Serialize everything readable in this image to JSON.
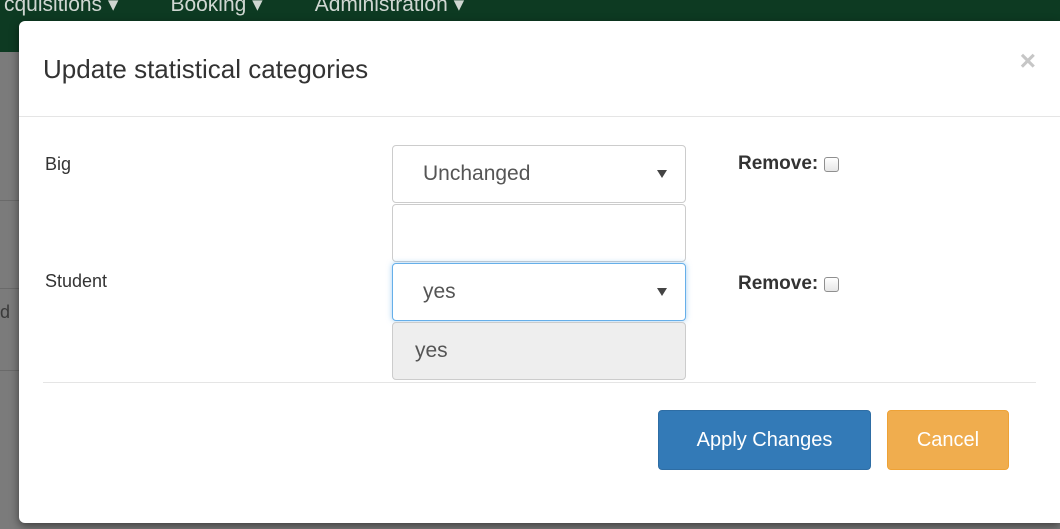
{
  "background": {
    "nav_items": [
      "cquisitions ▾",
      "Booking ▾",
      "Administration ▾"
    ],
    "edge_letter": "d"
  },
  "modal": {
    "title": "Update statistical categories",
    "close_symbol": "×",
    "rows": [
      {
        "label": "Big",
        "select_value": "Unchanged",
        "remove_label": "Remove:",
        "remove_checked": false
      },
      {
        "label": "Student",
        "select_value": "yes",
        "readonly_value": "yes",
        "remove_label": "Remove:",
        "remove_checked": false
      }
    ],
    "buttons": {
      "apply": "Apply Changes",
      "cancel": "Cancel"
    }
  },
  "colors": {
    "navbar": "#0d3a22",
    "primary": "#337ab7",
    "warning": "#f0ad4e"
  }
}
